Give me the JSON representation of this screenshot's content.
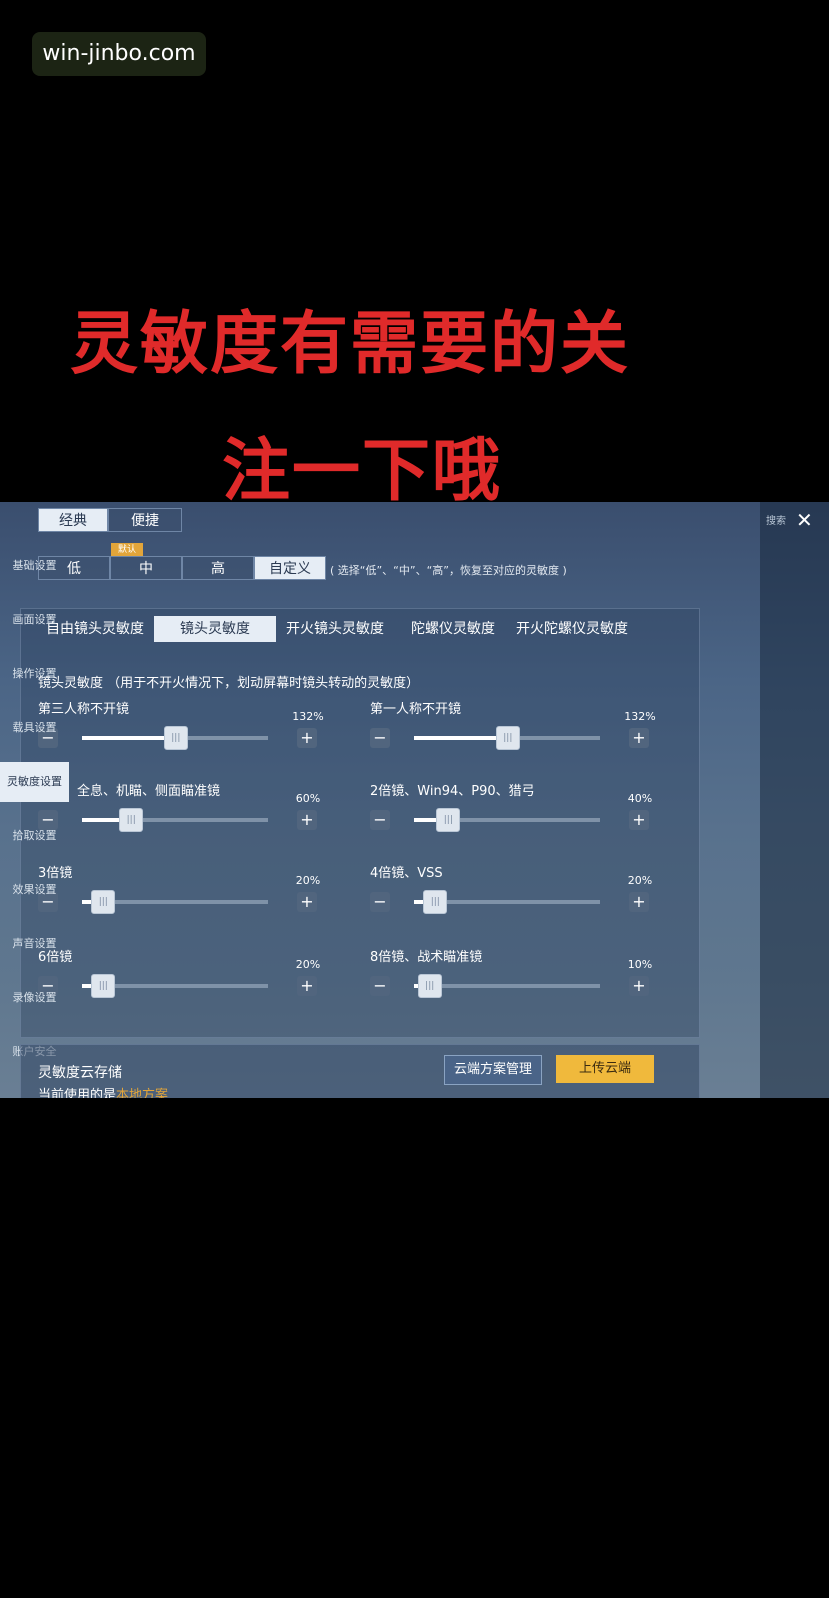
{
  "watermark": "win-jinbo.com",
  "headline": {
    "line1": "灵敏度有需要的关",
    "line2": "注一下哦"
  },
  "game": {
    "mode_tabs": [
      "经典",
      "便捷"
    ],
    "default_tag": "默认",
    "levels": [
      "低",
      "中",
      "高",
      "自定义"
    ],
    "level_hint": "( 选择“低”、“中”、“高”，恢复至对应的灵敏度 )",
    "sub_tabs": [
      "自由镜头灵敏度",
      "镜头灵敏度",
      "开火镜头灵敏度",
      "陀螺仪灵敏度",
      "开火陀螺仪灵敏度"
    ],
    "description": "镜头灵敏度 （用于不开火情况下，划动屏幕时镜头转动的灵敏度）",
    "sliders": [
      {
        "label": "第三人称不开镜",
        "value": "132%",
        "level": 0.44
      },
      {
        "label": "第一人称不开镜",
        "value": "132%",
        "level": 0.44
      },
      {
        "label": "红点、全息、机瞄、侧面瞄准镜",
        "value": "60%",
        "level": 0.2
      },
      {
        "label": "2倍镜、Win94、P90、猎弓",
        "value": "40%",
        "level": 0.12
      },
      {
        "label": "3倍镜",
        "value": "20%",
        "level": 0.05
      },
      {
        "label": "4倍镜、VSS",
        "value": "20%",
        "level": 0.05
      },
      {
        "label": "6倍镜",
        "value": "20%",
        "level": 0.05
      },
      {
        "label": "8倍镜、战术瞄准镜",
        "value": "10%",
        "level": 0.02
      }
    ],
    "minus": "−",
    "plus": "+",
    "sidebar": [
      "基础设置",
      "画面设置",
      "操作设置",
      "载具设置",
      "灵敏度设置",
      "拾取设置",
      "效果设置",
      "声音设置",
      "录像设置",
      "账户安全"
    ],
    "sidebar_active": "灵敏度设置",
    "search_label": "搜索",
    "close": "✕",
    "cloud": {
      "title": "灵敏度云存储",
      "subtitle_prefix": "当前使用的是",
      "subtitle_value": "本地方案",
      "manage_button": "云端方案管理",
      "upload_button": "上传云端"
    }
  }
}
